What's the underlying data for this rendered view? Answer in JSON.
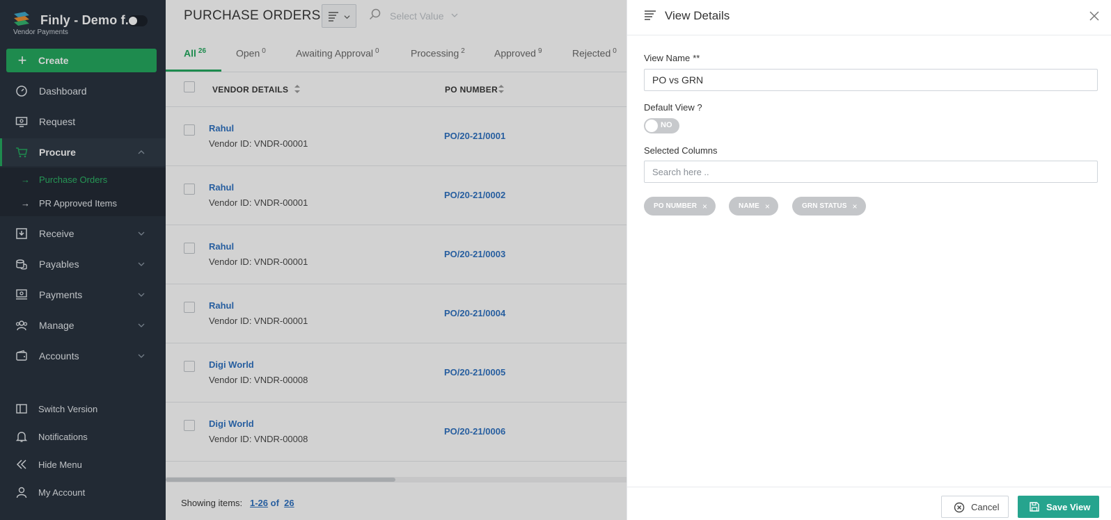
{
  "app": {
    "title": "Finly - Demo f...",
    "subtitle": "Vendor Payments",
    "brand_color": "#1ea75b"
  },
  "sidebar": {
    "create_label": "Create",
    "items": [
      {
        "label": "Dashboard",
        "icon": "speedometer-icon"
      },
      {
        "label": "Request",
        "icon": "request-icon"
      },
      {
        "label": "Procure",
        "icon": "cart-icon",
        "expanded": true
      },
      {
        "label": "Receive",
        "icon": "download-icon"
      },
      {
        "label": "Payables",
        "icon": "coins-icon"
      },
      {
        "label": "Payments",
        "icon": "payments-icon"
      },
      {
        "label": "Manage",
        "icon": "users-icon"
      },
      {
        "label": "Accounts",
        "icon": "wallet-icon"
      }
    ],
    "sub_items": [
      {
        "label": "Purchase Orders",
        "current": true
      },
      {
        "label": "PR Approved Items",
        "current": false
      }
    ],
    "bottom_items": [
      {
        "label": "Switch Version",
        "icon": "switch-icon"
      },
      {
        "label": "Notifications",
        "icon": "bell-icon"
      },
      {
        "label": "Hide Menu",
        "icon": "double-chevron-left-icon"
      },
      {
        "label": "My Account",
        "icon": "user-icon"
      }
    ]
  },
  "main": {
    "page_title": "PURCHASE ORDERS",
    "select_placeholder": "Select Value",
    "tabs": [
      {
        "label": "All",
        "count": "26",
        "active": true
      },
      {
        "label": "Open",
        "count": "0"
      },
      {
        "label": "Awaiting Approval",
        "count": "0"
      },
      {
        "label": "Processing",
        "count": "2"
      },
      {
        "label": "Approved",
        "count": "9"
      },
      {
        "label": "Rejected",
        "count": "0"
      }
    ],
    "columns": [
      "VENDOR DETAILS",
      "PO NUMBER"
    ],
    "rows": [
      {
        "vendor": "Rahul",
        "vendor_id": "Vendor ID: VNDR-00001",
        "po": "PO/20-21/0001"
      },
      {
        "vendor": "Rahul",
        "vendor_id": "Vendor ID: VNDR-00001",
        "po": "PO/20-21/0002"
      },
      {
        "vendor": "Rahul",
        "vendor_id": "Vendor ID: VNDR-00001",
        "po": "PO/20-21/0003"
      },
      {
        "vendor": "Rahul",
        "vendor_id": "Vendor ID: VNDR-00001",
        "po": "PO/20-21/0004"
      },
      {
        "vendor": "Digi World",
        "vendor_id": "Vendor ID: VNDR-00008",
        "po": "PO/20-21/0005"
      },
      {
        "vendor": "Digi World",
        "vendor_id": "Vendor ID: VNDR-00008",
        "po": "PO/20-21/0006"
      }
    ],
    "pagination": {
      "label": "Showing items:",
      "range": "1-26",
      "of": "of",
      "total": "26"
    }
  },
  "panel": {
    "title": "View Details",
    "view_name_label": "View Name",
    "view_name_required": "**",
    "view_name_value": "PO vs GRN",
    "default_view_label": "Default View ?",
    "default_view_toggle": "NO",
    "selected_columns_label": "Selected Columns",
    "search_placeholder": "Search here ..",
    "chips": [
      "PO NUMBER",
      "NAME",
      "GRN STATUS"
    ],
    "cancel_label": "Cancel",
    "save_label": "Save View",
    "save_color": "#26a48e"
  }
}
